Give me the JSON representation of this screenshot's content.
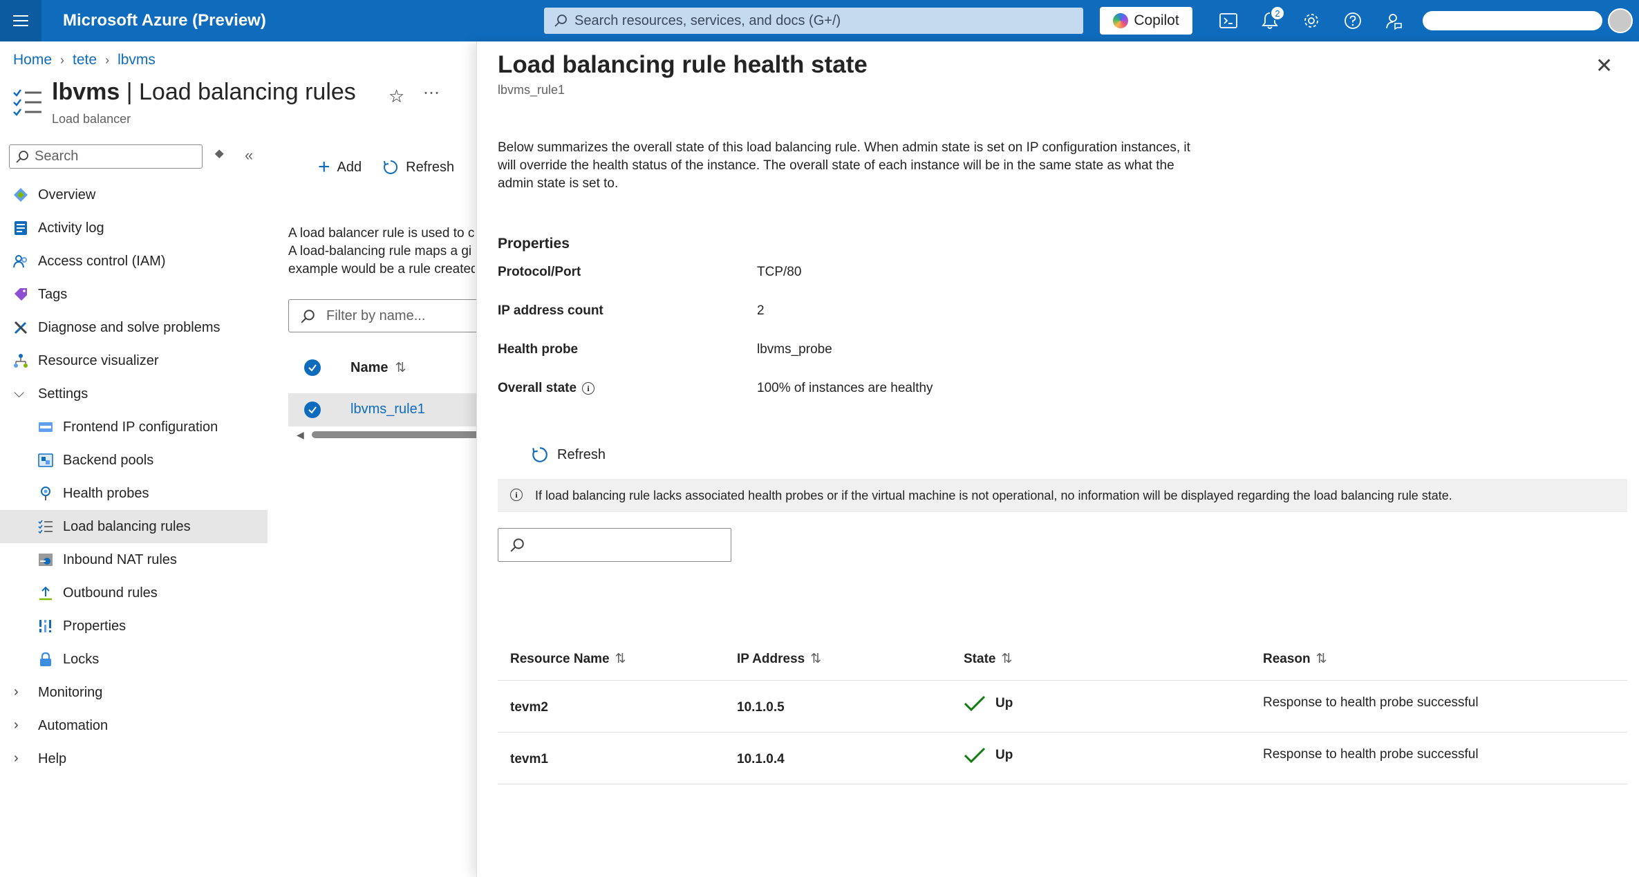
{
  "topbar": {
    "brand": "Microsoft Azure (Preview)",
    "search_placeholder": "Search resources, services, and docs (G+/)",
    "copilot_label": "Copilot",
    "notification_count": "2"
  },
  "breadcrumb": [
    "Home",
    "tete",
    "lbvms"
  ],
  "blade": {
    "title_resource": "lbvms",
    "title_sep": " | ",
    "title_page": "Load balancing rules",
    "subtitle": "Load balancer",
    "menu_search_placeholder": "Search"
  },
  "menu": {
    "items": [
      {
        "label": "Overview"
      },
      {
        "label": "Activity log"
      },
      {
        "label": "Access control (IAM)"
      },
      {
        "label": "Tags"
      },
      {
        "label": "Diagnose and solve problems"
      },
      {
        "label": "Resource visualizer"
      },
      {
        "label": "Settings"
      },
      {
        "label": "Frontend IP configuration"
      },
      {
        "label": "Backend pools"
      },
      {
        "label": "Health probes"
      },
      {
        "label": "Load balancing rules"
      },
      {
        "label": "Inbound NAT rules"
      },
      {
        "label": "Outbound rules"
      },
      {
        "label": "Properties"
      },
      {
        "label": "Locks"
      },
      {
        "label": "Monitoring"
      },
      {
        "label": "Automation"
      },
      {
        "label": "Help"
      }
    ]
  },
  "content": {
    "add_label": "Add",
    "refresh_label": "Refresh",
    "desc_lines": [
      "A load balancer rule is used to c",
      "A load-balancing rule maps a gi",
      "example would be a rule created"
    ],
    "filter_placeholder": "Filter by name...",
    "name_header": "Name",
    "rule_name": "lbvms_rule1"
  },
  "panel": {
    "title": "Load balancing rule health state",
    "subtitle": "lbvms_rule1",
    "description": "Below summarizes the overall state of this load balancing rule. When admin state is set on IP configuration instances, it will override the health status of the instance. The overall state of each instance will be in the same state as what the admin state is set to.",
    "properties_heading": "Properties",
    "properties": [
      {
        "key": "Protocol/Port",
        "value": "TCP/80"
      },
      {
        "key": "IP address count",
        "value": "2"
      },
      {
        "key": "Health probe",
        "value": "lbvms_probe"
      },
      {
        "key": "Overall state",
        "value": "100% of instances are healthy"
      }
    ],
    "refresh_label": "Refresh",
    "info_message": "If load balancing rule lacks associated health probes or if the virtual machine is not operational, no information will be displayed regarding the load balancing rule state.",
    "table": {
      "headers": [
        "Resource Name",
        "IP Address",
        "State",
        "Reason"
      ],
      "rows": [
        {
          "name": "tevm2",
          "ip": "10.1.0.5",
          "state": "Up",
          "reason": "Response to health probe successful"
        },
        {
          "name": "tevm1",
          "ip": "10.1.0.4",
          "state": "Up",
          "reason": "Response to health probe successful"
        }
      ]
    }
  },
  "colors": {
    "azure_blue": "#0f6cbd",
    "success_green": "#107c10"
  }
}
